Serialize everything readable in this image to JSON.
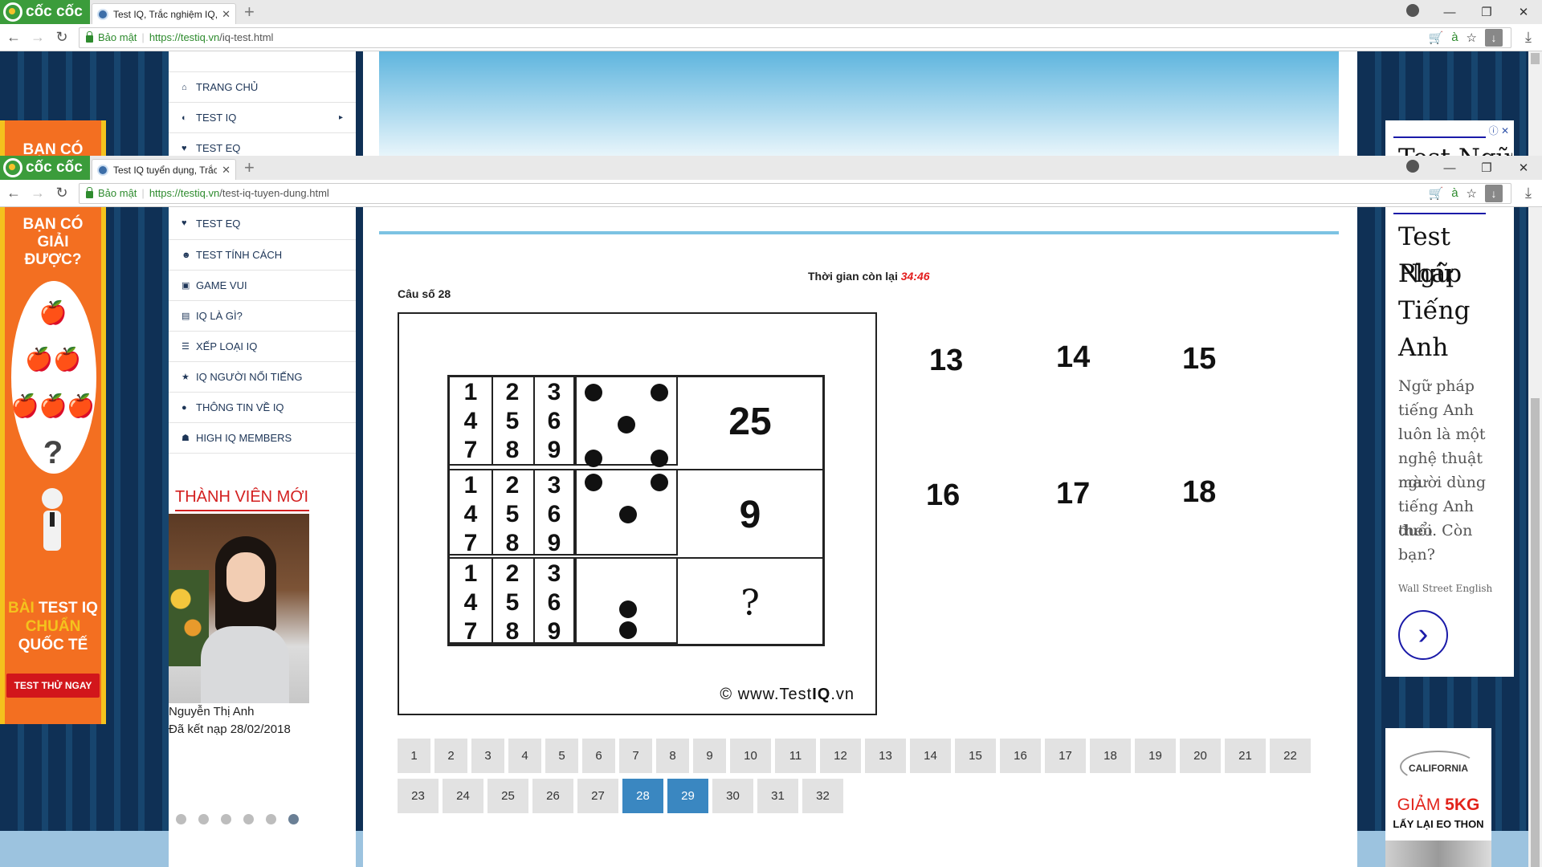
{
  "browser_back": {
    "brand": "cốc cốc",
    "tab_title": "Test IQ, Trắc nghiệm IQ, Ki",
    "secure_label": "Bảo mật",
    "url_host": "https://testiq.vn",
    "url_path": "/iq-test.html",
    "menu_partial": [
      "TRANG CHỦ",
      "TEST IQ",
      "TEST EQ"
    ],
    "left_ad_partial": "BẠN CÓ"
  },
  "browser_front": {
    "brand": "cốc cốc",
    "tab_title": "Test IQ tuyển dụng, Trắc n",
    "secure_label": "Bảo mật",
    "url_host": "https://testiq.vn",
    "url_path": "/test-iq-tuyen-dung.html"
  },
  "sidebar": {
    "items": [
      {
        "label": "TEST EQ",
        "icon": "heart-icon"
      },
      {
        "label": "TEST TÍNH CÁCH",
        "icon": "users-icon"
      },
      {
        "label": "GAME VUI",
        "icon": "gamepad-icon"
      },
      {
        "label": "IQ LÀ GÌ?",
        "icon": "book-icon"
      },
      {
        "label": "XẾP LOẠI IQ",
        "icon": "list-icon"
      },
      {
        "label": "IQ NGƯỜI NỔI TIẾNG",
        "icon": "star-icon"
      },
      {
        "label": "THÔNG TIN VỀ IQ",
        "icon": "info-icon"
      },
      {
        "label": "HIGH IQ MEMBERS",
        "icon": "group-icon"
      }
    ]
  },
  "member": {
    "title": "THÀNH VIÊN MỚI",
    "name": "Nguyễn Thị Anh",
    "joined": "Đã kết nạp 28/02/2018",
    "slide_count": 6,
    "active_slide": 6
  },
  "left_ad": {
    "title": [
      "BẠN CÓ",
      "GIẢI",
      "ĐƯỢC?"
    ],
    "question": "?",
    "sub_prefix": "BÀI",
    "sub_lines": [
      "TEST IQ",
      "CHUẨN",
      "QUỐC TẾ"
    ],
    "button": "TEST THỬ NGAY"
  },
  "quiz": {
    "timer_label": "Thời gian còn lại",
    "timer_value": "34:46",
    "question_label": "Câu số 28",
    "grid_numbers": [
      "1",
      "2",
      "3",
      "4",
      "5",
      "6",
      "7",
      "8",
      "9"
    ],
    "answers_shown": [
      "25",
      "9",
      "?"
    ],
    "watermark_prefix": "© www.Test",
    "watermark_bold": "IQ",
    "watermark_suffix": ".vn",
    "options": [
      "13",
      "14",
      "15",
      "16",
      "17",
      "18"
    ]
  },
  "pager": {
    "pages": [
      "1",
      "2",
      "3",
      "4",
      "5",
      "6",
      "7",
      "8",
      "9",
      "10",
      "11",
      "12",
      "13",
      "14",
      "15",
      "16",
      "17",
      "18",
      "19",
      "20",
      "21",
      "22",
      "23",
      "24",
      "25",
      "26",
      "27",
      "28",
      "29",
      "30",
      "31",
      "32"
    ],
    "highlighted": [
      "28",
      "29"
    ]
  },
  "right_ad": {
    "title": [
      "Test Ngữ",
      "Pháp",
      "Tiếng",
      "Anh"
    ],
    "body": [
      "Ngữ pháp",
      "tiếng Anh",
      "luôn là một",
      "nghệ thuật mà",
      "người dùng",
      "tiếng Anh theo",
      "đuổi. Còn",
      "bạn?"
    ],
    "source": "Wall Street English",
    "back_partial": "Test Ngữ"
  },
  "right_ad2": {
    "logo": "CALIFORNIA",
    "headline_prefix": "GIẢM ",
    "headline_bold": "5KG",
    "subline": "LẤY LẠI EO THON"
  },
  "colors": {
    "brand_green": "#3b9c3b",
    "page_navy": "#0f3055",
    "ad_orange": "#f36f21",
    "pager_active": "#3a87c1",
    "timer_red": "#e31c1c"
  }
}
